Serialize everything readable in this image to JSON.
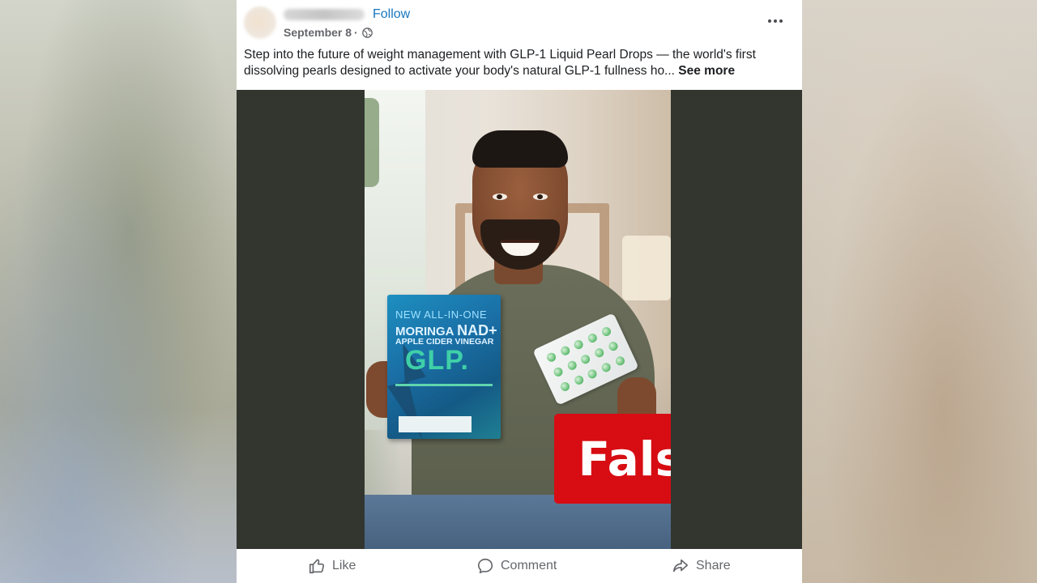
{
  "post": {
    "follow_label": "Follow",
    "date": "September 8",
    "dot": "·",
    "privacy_icon": "globe-icon",
    "text": "Step into the future of weight management with GLP-1 Liquid Pearl Drops — the world's first dissolving pearls designed to activate your body's natural GLP-1 fullness ho... ",
    "see_more_label": "See more"
  },
  "media": {
    "product_box": {
      "line1": "NEW ALL-IN-ONE",
      "line2a": "MORINGA ",
      "line2b": "NAD+",
      "line3": "APPLE CIDER VINEGAR",
      "line4": "GLP."
    },
    "rating_badge": "False"
  },
  "actions": {
    "like_label": "Like",
    "comment_label": "Comment",
    "share_label": "Share"
  },
  "colors": {
    "link_blue": "#1877c0",
    "false_red": "#d70d13",
    "media_bg": "#32362f"
  }
}
